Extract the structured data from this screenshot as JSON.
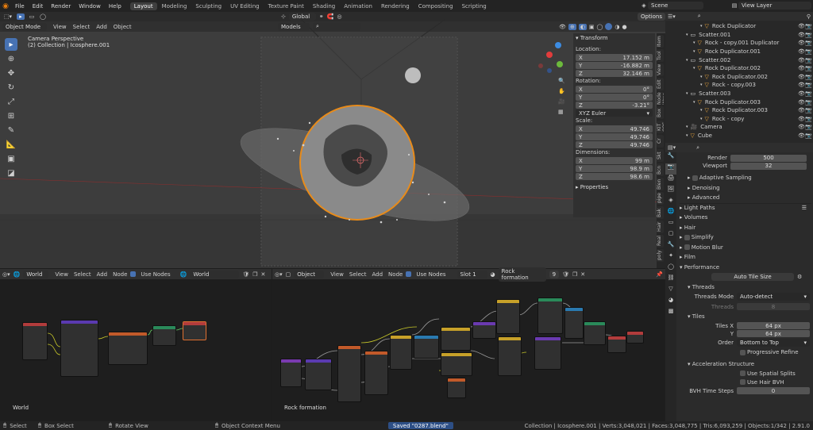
{
  "topbar": {
    "menus": [
      "File",
      "Edit",
      "Render",
      "Window",
      "Help"
    ],
    "workspaces": [
      {
        "label": "Layout",
        "active": true
      },
      {
        "label": "Modeling",
        "active": false
      },
      {
        "label": "Sculpting",
        "active": false
      },
      {
        "label": "UV Editing",
        "active": false
      },
      {
        "label": "Texture Paint",
        "active": false
      },
      {
        "label": "Shading",
        "active": false
      },
      {
        "label": "Animation",
        "active": false
      },
      {
        "label": "Rendering",
        "active": false
      },
      {
        "label": "Compositing",
        "active": false
      },
      {
        "label": "Scripting",
        "active": false
      }
    ],
    "scene": "Scene",
    "view_layer": "View Layer"
  },
  "viewport": {
    "transform_orientation": "Global",
    "options_label": "Options",
    "mode": "Object Mode",
    "header_menus": [
      "View",
      "Select",
      "Add",
      "Object"
    ],
    "camera_text": "Camera Perspective",
    "collection_text": "(2) Collection | Icosphere.001",
    "models_label": "Models"
  },
  "transform": {
    "title": "Transform",
    "location_label": "Location:",
    "location": [
      {
        "axis": "X",
        "value": "17.152 m"
      },
      {
        "axis": "Y",
        "value": "-16.882 m"
      },
      {
        "axis": "Z",
        "value": "32.146 m"
      }
    ],
    "rotation_label": "Rotation:",
    "rotation": [
      {
        "axis": "X",
        "value": "0°"
      },
      {
        "axis": "Y",
        "value": "0°"
      },
      {
        "axis": "Z",
        "value": "-3.21°"
      }
    ],
    "rotation_mode": "XYZ Euler",
    "scale_label": "Scale:",
    "scale": [
      {
        "axis": "X",
        "value": "49.746"
      },
      {
        "axis": "Y",
        "value": "49.746"
      },
      {
        "axis": "Z",
        "value": "49.746"
      }
    ],
    "dimensions_label": "Dimensions:",
    "dimensions": [
      {
        "axis": "X",
        "value": "99 m"
      },
      {
        "axis": "Y",
        "value": "98.9 m"
      },
      {
        "axis": "Z",
        "value": "98.6 m"
      }
    ],
    "properties_label": "Properties"
  },
  "side_tabs": [
    "Item",
    "Tool",
    "View",
    "Edit",
    "Node Wrangler",
    "Box",
    "KIT OPS",
    "Cr",
    "Skt",
    "Bcn",
    "Blen",
    "pipe",
    "Bak",
    "Hair",
    "Real",
    "poly"
  ],
  "outliner": {
    "items": [
      {
        "label": "Rock Duplicator",
        "indent": 2,
        "kind": "mesh"
      },
      {
        "label": "Scatter.001",
        "indent": 0,
        "kind": "collection"
      },
      {
        "label": "Rock - copy.001 Duplicator",
        "indent": 1,
        "kind": "mesh"
      },
      {
        "label": "Rock Duplicator.001",
        "indent": 1,
        "kind": "mesh"
      },
      {
        "label": "Scatter.002",
        "indent": 0,
        "kind": "collection"
      },
      {
        "label": "Rock Duplicator.002",
        "indent": 1,
        "kind": "mesh"
      },
      {
        "label": "Rock Duplicator.002",
        "indent": 2,
        "kind": "mesh"
      },
      {
        "label": "Rock - copy.003",
        "indent": 2,
        "kind": "mesh"
      },
      {
        "label": "Scatter.003",
        "indent": 0,
        "kind": "collection"
      },
      {
        "label": "Rock Duplicator.003",
        "indent": 1,
        "kind": "mesh"
      },
      {
        "label": "Rock Duplicator.003",
        "indent": 2,
        "kind": "mesh"
      },
      {
        "label": "Rock - copy",
        "indent": 2,
        "kind": "mesh"
      },
      {
        "label": "Camera",
        "indent": 0,
        "kind": "camera"
      },
      {
        "label": "Cube",
        "indent": 0,
        "kind": "mesh"
      }
    ]
  },
  "properties": {
    "render_label": "Render",
    "render_value": "500",
    "viewport_label": "Viewport",
    "viewport_value": "32",
    "adaptive_sampling": "Adaptive Sampling",
    "denoising": "Denoising",
    "advanced": "Advanced",
    "light_paths": "Light Paths",
    "volumes": "Volumes",
    "hair": "Hair",
    "simplify": "Simplify",
    "motion_blur": "Motion Blur",
    "film": "Film",
    "performance": "Performance",
    "auto_tile_size": "Auto Tile Size",
    "threads": "Threads",
    "threads_mode_label": "Threads Mode",
    "threads_mode_value": "Auto-detect",
    "threads_label": "Threads",
    "threads_value": "8",
    "tiles": "Tiles",
    "tiles_x_label": "Tiles X",
    "tiles_x_value": "64 px",
    "tiles_y_label": "Y",
    "tiles_y_value": "64 px",
    "order_label": "Order",
    "order_value": "Bottom to Top",
    "progressive_refine": "Progressive Refine",
    "accel_structure": "Acceleration Structure",
    "use_spatial_splits": "Use Spatial Splits",
    "use_hair_bvh": "Use Hair BVH",
    "bvh_time_steps_label": "BVH Time Steps",
    "bvh_time_steps_value": "0"
  },
  "world_editor": {
    "type_label": "World",
    "menus": [
      "View",
      "Select",
      "Add",
      "Node"
    ],
    "use_nodes": "Use Nodes",
    "datablock": "World",
    "corner_label": "World"
  },
  "rock_editor": {
    "type_label": "Object",
    "menus": [
      "View",
      "Select",
      "Add",
      "Node"
    ],
    "use_nodes": "Use Nodes",
    "slot": "Slot 1",
    "material": "Rock formation",
    "users": "9",
    "corner_label": "Rock formation"
  },
  "statusbar": {
    "select": "Select",
    "box_select": "Box Select",
    "rotate_view": "Rotate View",
    "context_menu": "Object Context Menu",
    "saved": "Saved \"0287.blend\"",
    "stats": "Collection | Icosphere.001 | Verts:3,048,021 | Faces:3,048,775 | Tris:6,093,259 | Objects:1/342 | 2.91.0"
  }
}
